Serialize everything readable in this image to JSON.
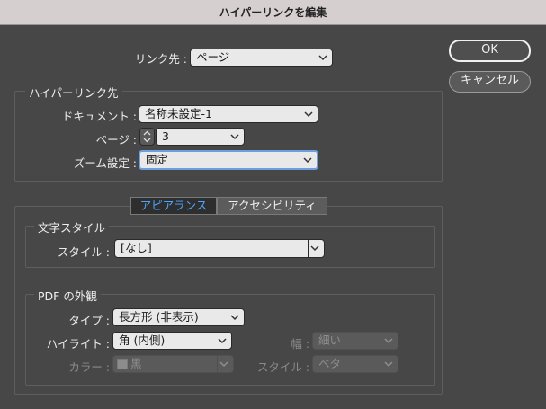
{
  "window": {
    "title": "ハイパーリンクを編集"
  },
  "buttons": {
    "ok": "OK",
    "cancel": "キャンセル"
  },
  "link_to": {
    "label": "リンク先 :",
    "value": "ページ"
  },
  "destination": {
    "title": "ハイパーリンク先",
    "document_label": "ドキュメント :",
    "document_value": "名称未設定-1",
    "page_label": "ページ :",
    "page_value": "3",
    "zoom_label": "ズーム設定 :",
    "zoom_value": "固定"
  },
  "tabs": [
    {
      "label": "アピアランス",
      "active": true
    },
    {
      "label": "アクセシビリティ",
      "active": false
    }
  ],
  "char_style": {
    "title": "文字スタイル",
    "style_label": "スタイル :",
    "style_value": "[なし]"
  },
  "pdf_appearance": {
    "title": "PDF の外観",
    "type_label": "タイプ :",
    "type_value": "長方形 (非表示)",
    "highlight_label": "ハイライト :",
    "highlight_value": "角 (内側)",
    "width_label": "幅 :",
    "width_value": "細い",
    "color_label": "カラー :",
    "color_value": "黒",
    "style_label": "スタイル :",
    "style_value": "ベタ"
  }
}
